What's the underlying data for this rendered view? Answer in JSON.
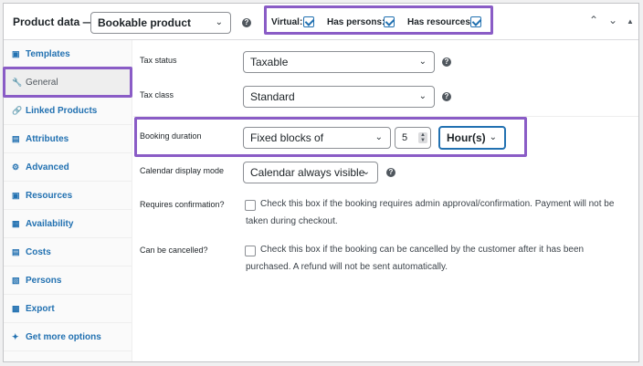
{
  "header": {
    "title": "Product data —",
    "product_type": "Bookable product",
    "checkboxes": [
      {
        "label": "Virtual:",
        "checked": true
      },
      {
        "label": "Has persons:",
        "checked": true
      },
      {
        "label": "Has resources:",
        "checked": true
      }
    ]
  },
  "sidebar": {
    "items": [
      {
        "label": "Templates",
        "icon": "templates-icon"
      },
      {
        "label": "General",
        "icon": "wrench-icon"
      },
      {
        "label": "Linked Products",
        "icon": "link-icon"
      },
      {
        "label": "Attributes",
        "icon": "list-icon"
      },
      {
        "label": "Advanced",
        "icon": "gear-icon"
      },
      {
        "label": "Resources",
        "icon": "resources-icon"
      },
      {
        "label": "Availability",
        "icon": "calendar-icon"
      },
      {
        "label": "Costs",
        "icon": "costs-icon"
      },
      {
        "label": "Persons",
        "icon": "persons-icon"
      },
      {
        "label": "Export",
        "icon": "export-icon"
      },
      {
        "label": "Get more options",
        "icon": "star-icon"
      }
    ]
  },
  "fields": {
    "tax_status": {
      "label": "Tax status",
      "value": "Taxable"
    },
    "tax_class": {
      "label": "Tax class",
      "value": "Standard"
    },
    "booking_duration": {
      "label": "Booking duration",
      "type_value": "Fixed blocks of",
      "amount": "5",
      "unit": "Hour(s)"
    },
    "calendar_display": {
      "label": "Calendar display mode",
      "value": "Calendar always visible"
    },
    "requires_confirmation": {
      "label": "Requires confirmation?",
      "description": "Check this box if the booking requires admin approval/confirmation. Payment will not be taken during checkout."
    },
    "can_be_cancelled": {
      "label": "Can be cancelled?",
      "description": "Check this box if the booking can be cancelled by the customer after it has been purchased. A refund will not be sent automatically."
    }
  },
  "colors": {
    "accent": "#2271b1",
    "highlight": "#8a5cc6"
  }
}
